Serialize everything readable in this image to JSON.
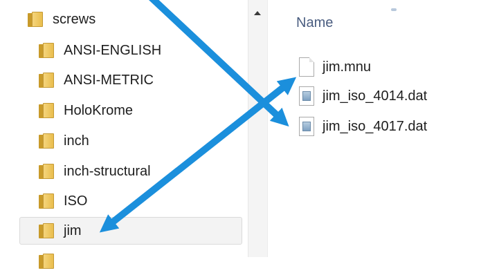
{
  "tree": {
    "items": [
      {
        "label": "screws"
      },
      {
        "label": "ANSI-ENGLISH"
      },
      {
        "label": "ANSI-METRIC"
      },
      {
        "label": "HoloKrome"
      },
      {
        "label": "inch"
      },
      {
        "label": "inch-structural"
      },
      {
        "label": "ISO"
      },
      {
        "label": "jim",
        "selected": true
      }
    ]
  },
  "file_list": {
    "column_header": "Name",
    "files": [
      {
        "name": "jim.mnu",
        "icon": "blank-file-icon"
      },
      {
        "name": "jim_iso_4014.dat",
        "icon": "dat-file-icon"
      },
      {
        "name": "jim_iso_4017.dat",
        "icon": "dat-file-icon"
      }
    ]
  },
  "annotations": {
    "arrow_color": "#1b8fdc"
  }
}
